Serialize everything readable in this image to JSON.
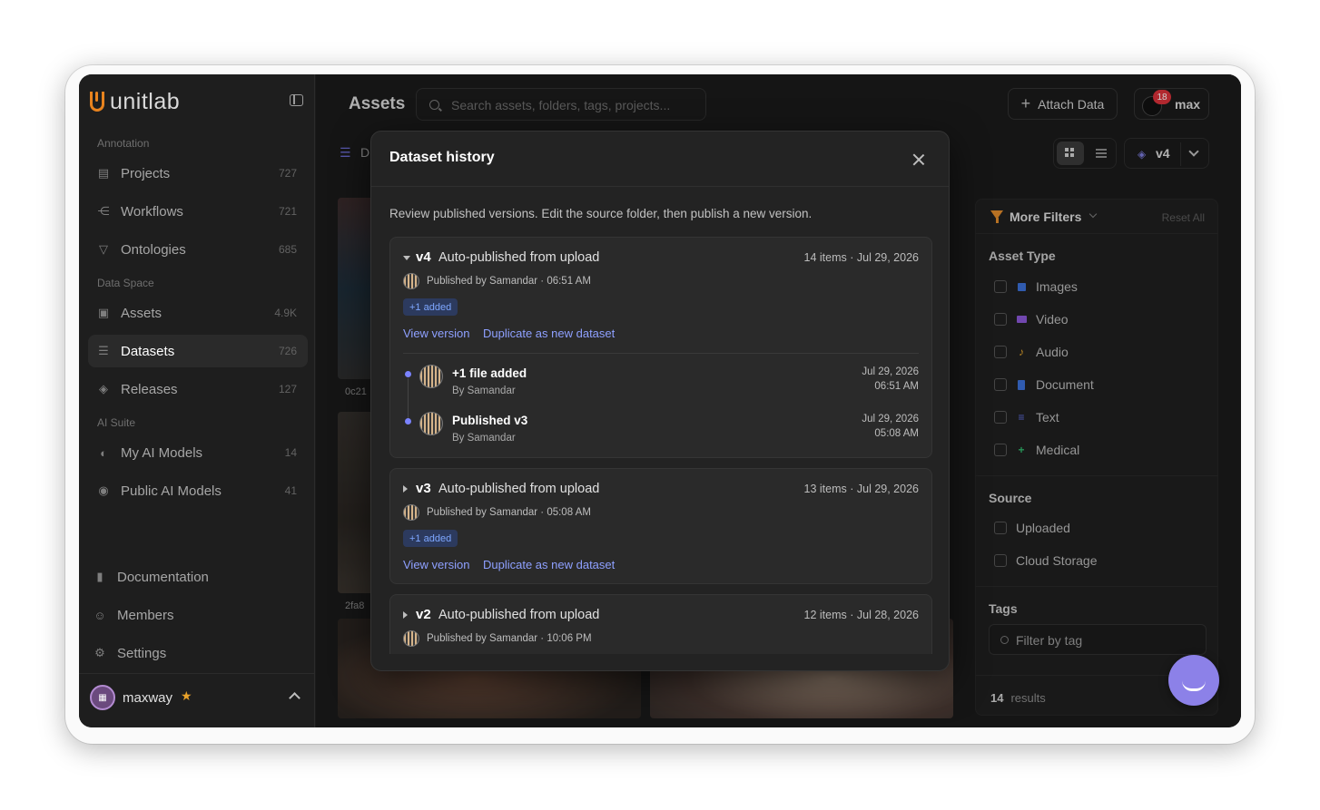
{
  "app": {
    "brand": "unitlab"
  },
  "sidebar": {
    "sections": {
      "annotation": "Annotation",
      "data_space": "Data Space",
      "ai_suite": "AI Suite"
    },
    "items": [
      {
        "label": "Projects",
        "count": "727",
        "icon": "projects-icon"
      },
      {
        "label": "Workflows",
        "count": "721",
        "icon": "workflows-icon"
      },
      {
        "label": "Ontologies",
        "count": "685",
        "icon": "ontologies-icon"
      },
      {
        "label": "Assets",
        "count": "4.9K",
        "icon": "assets-icon"
      },
      {
        "label": "Datasets",
        "count": "726",
        "icon": "datasets-icon"
      },
      {
        "label": "Releases",
        "count": "127",
        "icon": "releases-icon"
      },
      {
        "label": "My AI Models",
        "count": "14",
        "icon": "ai-model-icon"
      },
      {
        "label": "Public AI Models",
        "count": "41",
        "icon": "public-ai-icon"
      }
    ],
    "bottom": [
      {
        "label": "Documentation",
        "icon": "documentation-icon"
      },
      {
        "label": "Members",
        "icon": "members-icon"
      },
      {
        "label": "Settings",
        "icon": "settings-icon"
      }
    ],
    "user": {
      "name": "maxway"
    }
  },
  "header": {
    "title": "Assets",
    "search_placeholder": "Search assets, folders, tags, projects...",
    "attach_label": "Attach Data",
    "notif_count": "18",
    "user_name": "max",
    "version": "v4",
    "breadcrumb_initial": "D"
  },
  "thumbs": {
    "label_1": "0c21",
    "label_2": "2fa8"
  },
  "filters": {
    "title": "More Filters",
    "reset": "Reset All",
    "asset_type_title": "Asset Type",
    "asset_types": [
      {
        "label": "Images",
        "color": "#3b6fd6"
      },
      {
        "label": "Video",
        "color": "#8a57d6"
      },
      {
        "label": "Audio",
        "color": "#e0a22b"
      },
      {
        "label": "Document",
        "color": "#3b6fd6"
      },
      {
        "label": "Text",
        "color": "#5b6ad6"
      },
      {
        "label": "Medical",
        "color": "#2fb36a"
      }
    ],
    "source_title": "Source",
    "sources": [
      "Uploaded",
      "Cloud Storage"
    ],
    "tags_title": "Tags",
    "tag_placeholder": "Filter by tag",
    "results_count": "14",
    "results_label": "results"
  },
  "modal": {
    "title": "Dataset history",
    "description": "Review published versions. Edit the source folder, then publish a new version.",
    "versions": [
      {
        "version": "v4",
        "title": "Auto-published from upload",
        "meta": "14 items · Jul 29, 2026",
        "published_by": "Published by Samandar · 06:51 AM",
        "badge": "+1 added",
        "view_link": "View version",
        "duplicate_link": "Duplicate as new dataset",
        "timeline": [
          {
            "title": "+1 file added",
            "by": "By Samandar",
            "date": "Jul 29, 2026",
            "time": "06:51 AM"
          },
          {
            "title": "Published v3",
            "by": "By Samandar",
            "date": "Jul 29, 2026",
            "time": "05:08 AM"
          }
        ]
      },
      {
        "version": "v3",
        "title": "Auto-published from upload",
        "meta": "13 items · Jul 29, 2026",
        "published_by": "Published by Samandar · 05:08 AM",
        "badge": "+1 added",
        "view_link": "View version",
        "duplicate_link": "Duplicate as new dataset"
      },
      {
        "version": "v2",
        "title": "Auto-published from upload",
        "meta": "12 items · Jul 28, 2026",
        "published_by": "Published by Samandar · 10:06 PM"
      }
    ]
  }
}
